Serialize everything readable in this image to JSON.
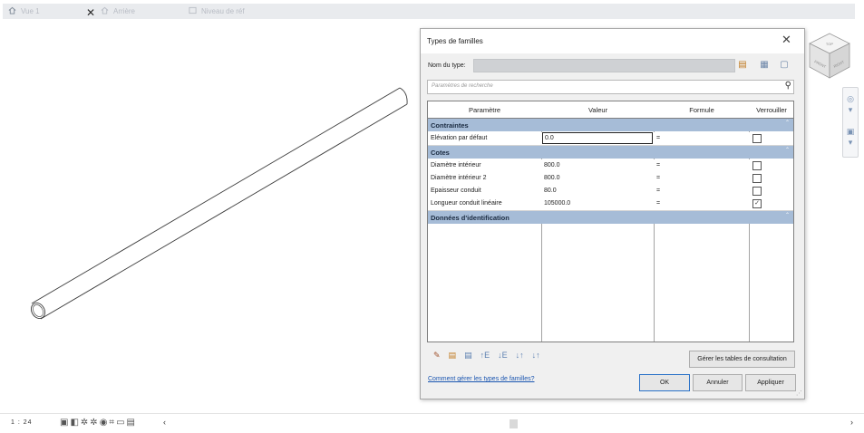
{
  "tabs": [
    {
      "icon": "house-icon",
      "label": "Vue 1"
    },
    {
      "icon": "house-icon",
      "label": "Arrière"
    },
    {
      "icon": "sheet-icon",
      "label": "Niveau de réf"
    }
  ],
  "viewcube": {
    "top": "TOP",
    "left": "FRONT",
    "right": "RIGHT"
  },
  "status": {
    "scale": "1 : 24"
  },
  "dialog": {
    "title": "Types de familles",
    "type_label": "Nom du type:",
    "type_value": "",
    "search_placeholder": "Paramètres de recherche",
    "columns": [
      "Paramètre",
      "Valeur",
      "Formule",
      "Verrouiller"
    ],
    "groups": [
      {
        "label": "Contraintes",
        "rows": [
          {
            "param": "Elévation par défaut",
            "value": "0.0",
            "formula": "=",
            "locked": false
          }
        ]
      },
      {
        "label": "Cotes",
        "rows": [
          {
            "param": "Diamètre intérieur",
            "value": "800.0",
            "formula": "=",
            "locked": false
          },
          {
            "param": "Diamètre intérieur 2",
            "value": "800.0",
            "formula": "=",
            "locked": false
          },
          {
            "param": "Epaisseur conduit",
            "value": "80.0",
            "formula": "=",
            "locked": false
          },
          {
            "param": "Longueur conduit linéaire",
            "value": "105000.0",
            "formula": "=",
            "locked": true
          }
        ]
      },
      {
        "label": "Données d'identification",
        "rows": []
      }
    ],
    "manage_button": "Gérer les tables de consultation",
    "help_link": "Comment gérer les types de familles?",
    "ok": "OK",
    "cancel": "Annuler",
    "apply": "Appliquer"
  },
  "colors": {
    "group_header": "#a6bcd7",
    "link": "#1a55b0",
    "tabstrip": "#e9ebee"
  }
}
